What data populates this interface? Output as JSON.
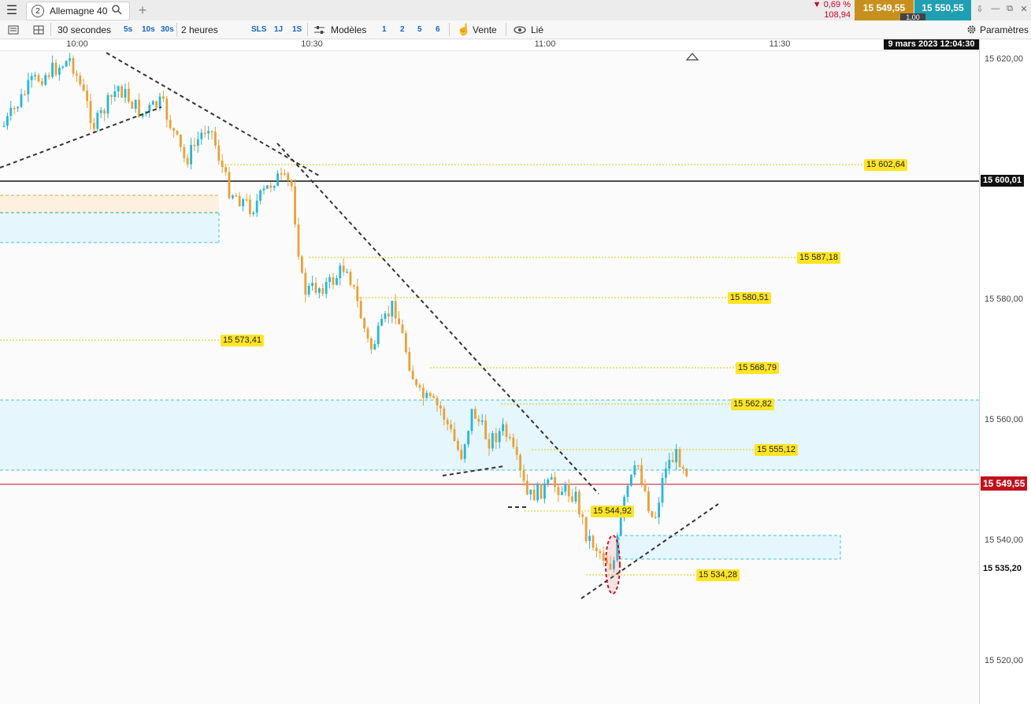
{
  "header": {
    "menu_icon": "hamburger-menu-icon",
    "tab_number": "2",
    "tab_label": "Allemagne 40",
    "search_icon": "search-icon",
    "add_tab_icon": "plus-icon",
    "change_pct": "▼ 0,69 %",
    "change_pts": "108,94",
    "sell_price": "15 549,55",
    "buy_price": "15 550,55",
    "spread": "1,00",
    "colors": {
      "sell": "#c7901e",
      "buy": "#1f9fb1",
      "negative": "#d0021b"
    }
  },
  "toolbar": {
    "layout_icon": "single-window-icon",
    "grid_icon": "grid-layout-icon",
    "interval_label": "30 secondes",
    "quick_intervals": [
      "5s",
      "10s",
      "30s"
    ],
    "range_label": "2 heures",
    "quick_ranges": [
      "SLS",
      "1J",
      "1S"
    ],
    "templates_icon": "sliders-icon",
    "templates_label": "Modèles",
    "quick_templates": [
      "1",
      "2",
      "5",
      "6"
    ],
    "mode_icon": "hand-icon",
    "mode_label": "Vente",
    "link_icon": "eye-icon",
    "link_label": "Lié",
    "settings_icon": "gear-icon",
    "settings_label": "Paramètres"
  },
  "axes": {
    "time_ticks": [
      "10:00",
      "10:30",
      "11:00",
      "11:30"
    ],
    "datetime": "9 mars 2023 12:04:30",
    "price_ticks": [
      "15 620,00",
      "15 580,00",
      "15 560,00",
      "15 540,00",
      "15 520,00"
    ],
    "current_price_badge": "15 549,55",
    "round_level_badge": "15 600,01",
    "low_badge": "15 535,20"
  },
  "levels": [
    "15 602,64",
    "15 587,18",
    "15 580,51",
    "15 573,41",
    "15 568,79",
    "15 562,82",
    "15 555,12",
    "15 544,92",
    "15 534,28"
  ]
}
